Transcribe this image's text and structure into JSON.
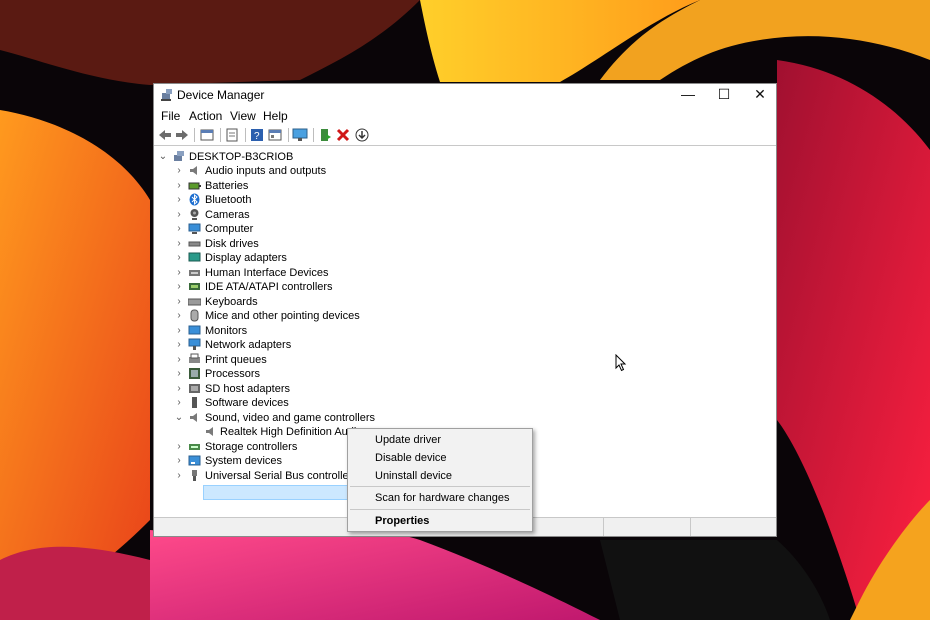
{
  "window": {
    "title": "Device Manager",
    "controls": {
      "minimize": "—",
      "maximize": "☐",
      "close": "✕"
    }
  },
  "menu": [
    "File",
    "Action",
    "View",
    "Help"
  ],
  "toolbar_icons": [
    "back-icon",
    "forward-icon",
    "properties-icon",
    "driver-icon",
    "help-icon",
    "view-icon",
    "monitor-icon",
    "enable-icon",
    "uninstall-icon",
    "update-icon"
  ],
  "tree": {
    "root": "DESKTOP-B3CRIOB",
    "items": [
      {
        "label": "Audio inputs and outputs",
        "icon": "speaker-icon"
      },
      {
        "label": "Batteries",
        "icon": "battery-icon"
      },
      {
        "label": "Bluetooth",
        "icon": "bluetooth-icon"
      },
      {
        "label": "Cameras",
        "icon": "camera-icon"
      },
      {
        "label": "Computer",
        "icon": "computer-icon"
      },
      {
        "label": "Disk drives",
        "icon": "disk-icon"
      },
      {
        "label": "Display adapters",
        "icon": "display-icon"
      },
      {
        "label": "Human Interface Devices",
        "icon": "hid-icon"
      },
      {
        "label": "IDE ATA/ATAPI controllers",
        "icon": "ide-icon"
      },
      {
        "label": "Keyboards",
        "icon": "keyboard-icon"
      },
      {
        "label": "Mice and other pointing devices",
        "icon": "mouse-icon"
      },
      {
        "label": "Monitors",
        "icon": "monitor-icon"
      },
      {
        "label": "Network adapters",
        "icon": "network-icon"
      },
      {
        "label": "Print queues",
        "icon": "printer-icon"
      },
      {
        "label": "Processors",
        "icon": "processor-icon"
      },
      {
        "label": "SD host adapters",
        "icon": "sd-icon"
      },
      {
        "label": "Software devices",
        "icon": "software-icon"
      },
      {
        "label": "Sound, video and game controllers",
        "icon": "speaker-icon",
        "expanded": true
      },
      {
        "label": "Realtek High Definition Audio",
        "icon": "speaker-icon",
        "child": true,
        "selected": true
      },
      {
        "label": "Storage controllers",
        "icon": "storage-icon"
      },
      {
        "label": "System devices",
        "icon": "system-icon"
      },
      {
        "label": "Universal Serial Bus controllers",
        "icon": "usb-icon"
      }
    ]
  },
  "context_menu": {
    "items": [
      "Update driver",
      "Disable device",
      "Uninstall device",
      "Scan for hardware changes",
      "Properties"
    ]
  },
  "colors": {
    "selection": "#cce8ff",
    "selection_border": "#99d1ff",
    "menu_bg": "#f2f2f2"
  }
}
